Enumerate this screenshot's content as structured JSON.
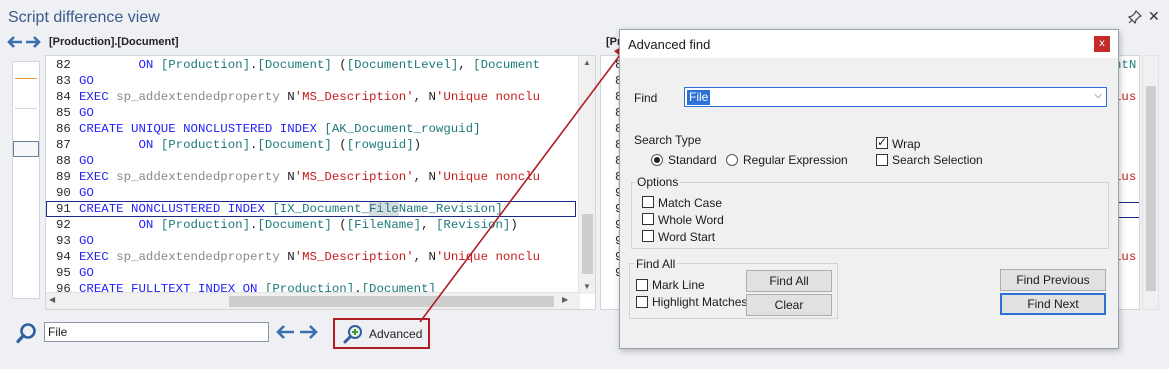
{
  "window": {
    "title": "Script difference view"
  },
  "left_pane": {
    "object_name": "[Production].[Document]",
    "lines": [
      {
        "num": "82",
        "segments": [
          [
            "pl",
            "        "
          ],
          [
            "kw",
            "ON"
          ],
          [
            "pl",
            " "
          ],
          [
            "id",
            "[Production]"
          ],
          [
            "pl",
            "."
          ],
          [
            "id",
            "[Document]"
          ],
          [
            "pl",
            " ("
          ],
          [
            "id",
            "[DocumentLevel]"
          ],
          [
            "pl",
            ", "
          ],
          [
            "id",
            "[Document"
          ]
        ]
      },
      {
        "num": "83",
        "segments": [
          [
            "kw",
            "GO"
          ]
        ]
      },
      {
        "num": "84",
        "segments": [
          [
            "kw",
            "EXEC"
          ],
          [
            "pl",
            " "
          ],
          [
            "gray",
            "sp_addextendedproperty"
          ],
          [
            "pl",
            " "
          ],
          [
            "pl",
            "N"
          ],
          [
            "str",
            "'MS_Description'"
          ],
          [
            "pl",
            ", N"
          ],
          [
            "str",
            "'Unique nonclu"
          ]
        ]
      },
      {
        "num": "85",
        "segments": [
          [
            "kw",
            "GO"
          ]
        ]
      },
      {
        "num": "86",
        "segments": [
          [
            "kw",
            "CREATE UNIQUE NONCLUSTERED INDEX"
          ],
          [
            "pl",
            " "
          ],
          [
            "id",
            "[AK_Document_rowguid]"
          ]
        ]
      },
      {
        "num": "87",
        "segments": [
          [
            "pl",
            "        "
          ],
          [
            "kw",
            "ON"
          ],
          [
            "pl",
            " "
          ],
          [
            "id",
            "[Production]"
          ],
          [
            "pl",
            "."
          ],
          [
            "id",
            "[Document]"
          ],
          [
            "pl",
            " ("
          ],
          [
            "id",
            "[rowguid]"
          ],
          [
            "pl",
            ")"
          ]
        ]
      },
      {
        "num": "88",
        "segments": [
          [
            "kw",
            "GO"
          ]
        ]
      },
      {
        "num": "89",
        "segments": [
          [
            "kw",
            "EXEC"
          ],
          [
            "pl",
            " "
          ],
          [
            "gray",
            "sp_addextendedproperty"
          ],
          [
            "pl",
            " "
          ],
          [
            "pl",
            "N"
          ],
          [
            "str",
            "'MS_Description'"
          ],
          [
            "pl",
            ", N"
          ],
          [
            "str",
            "'Unique nonclu"
          ]
        ]
      },
      {
        "num": "90",
        "segments": [
          [
            "kw",
            "GO"
          ]
        ]
      },
      {
        "num": "91",
        "highlight": true,
        "segments": [
          [
            "kw",
            "CREATE NONCLUSTERED INDEX"
          ],
          [
            "pl",
            " "
          ],
          [
            "id",
            "[IX_Document_"
          ],
          [
            "hl",
            "File"
          ],
          [
            "id",
            "Name_Revision]"
          ]
        ]
      },
      {
        "num": "92",
        "segments": [
          [
            "pl",
            "        "
          ],
          [
            "kw",
            "ON"
          ],
          [
            "pl",
            " "
          ],
          [
            "id",
            "[Production]"
          ],
          [
            "pl",
            "."
          ],
          [
            "id",
            "[Document]"
          ],
          [
            "pl",
            " ("
          ],
          [
            "id",
            "[FileName]"
          ],
          [
            "pl",
            ", "
          ],
          [
            "id",
            "[Revision]"
          ],
          [
            "pl",
            ")"
          ]
        ]
      },
      {
        "num": "93",
        "segments": [
          [
            "kw",
            "GO"
          ]
        ]
      },
      {
        "num": "94",
        "segments": [
          [
            "kw",
            "EXEC"
          ],
          [
            "pl",
            " "
          ],
          [
            "gray",
            "sp_addextendedproperty"
          ],
          [
            "pl",
            " "
          ],
          [
            "pl",
            "N"
          ],
          [
            "str",
            "'MS_Description'"
          ],
          [
            "pl",
            ", N"
          ],
          [
            "str",
            "'Unique nonclu"
          ]
        ]
      },
      {
        "num": "95",
        "segments": [
          [
            "kw",
            "GO"
          ]
        ]
      },
      {
        "num": "96",
        "segments": [
          [
            "kw",
            "CREATE FULLTEXT INDEX ON"
          ],
          [
            "pl",
            " "
          ],
          [
            "id",
            "[Production]"
          ],
          [
            "pl",
            "."
          ],
          [
            "id",
            "[Document]"
          ]
        ]
      }
    ]
  },
  "right_pane": {
    "object_name": "[Pr",
    "line_prefix": [
      "8",
      "8",
      "8",
      "8",
      "8",
      "8",
      "8",
      "8",
      "9",
      "9",
      "9",
      "9",
      "9",
      "9"
    ],
    "line_suffix": [
      [
        "id",
        "ntN"
      ],
      [
        "pl",
        ""
      ],
      [
        "str",
        "lus"
      ],
      [
        "pl",
        ""
      ],
      [
        "pl",
        ""
      ],
      [
        "pl",
        ""
      ],
      [
        "pl",
        ""
      ],
      [
        "str",
        "lus"
      ],
      [
        "pl",
        ""
      ],
      [
        "pl",
        ""
      ],
      [
        "pl",
        ""
      ],
      [
        "pl",
        ""
      ],
      [
        "str",
        "lus"
      ],
      [
        "pl",
        ""
      ]
    ]
  },
  "bottom_bar": {
    "search_value": "File",
    "advanced_label": "Advanced"
  },
  "dialog": {
    "title": "Advanced find",
    "close_glyph": "x",
    "find_label": "Find",
    "find_value": "File",
    "search_type_label": "Search Type",
    "standard_label": "Standard",
    "regex_label": "Regular Expression",
    "wrap_label": "Wrap",
    "search_selection_label": "Search Selection",
    "options_label": "Options",
    "match_case_label": "Match Case",
    "whole_word_label": "Whole Word",
    "word_start_label": "Word Start",
    "find_all_group_label": "Find All",
    "mark_line_label": "Mark Line",
    "highlight_matches_label": "Highlight Matches",
    "find_all_button": "Find All",
    "clear_button": "Clear",
    "find_previous_button": "Find Previous",
    "find_next_button": "Find Next"
  },
  "state": {
    "standard_selected": true,
    "regex_selected": false,
    "wrap_checked": true,
    "search_selection_checked": false,
    "match_case_checked": false,
    "whole_word_checked": false,
    "word_start_checked": false,
    "mark_line_checked": false,
    "highlight_matches_checked": false
  },
  "colors": {
    "keyword": "#1f1fff",
    "identifier": "#1e7a7a",
    "string": "#c81e1e",
    "annotation": "#b01e23",
    "selection": "#2c71d5"
  }
}
